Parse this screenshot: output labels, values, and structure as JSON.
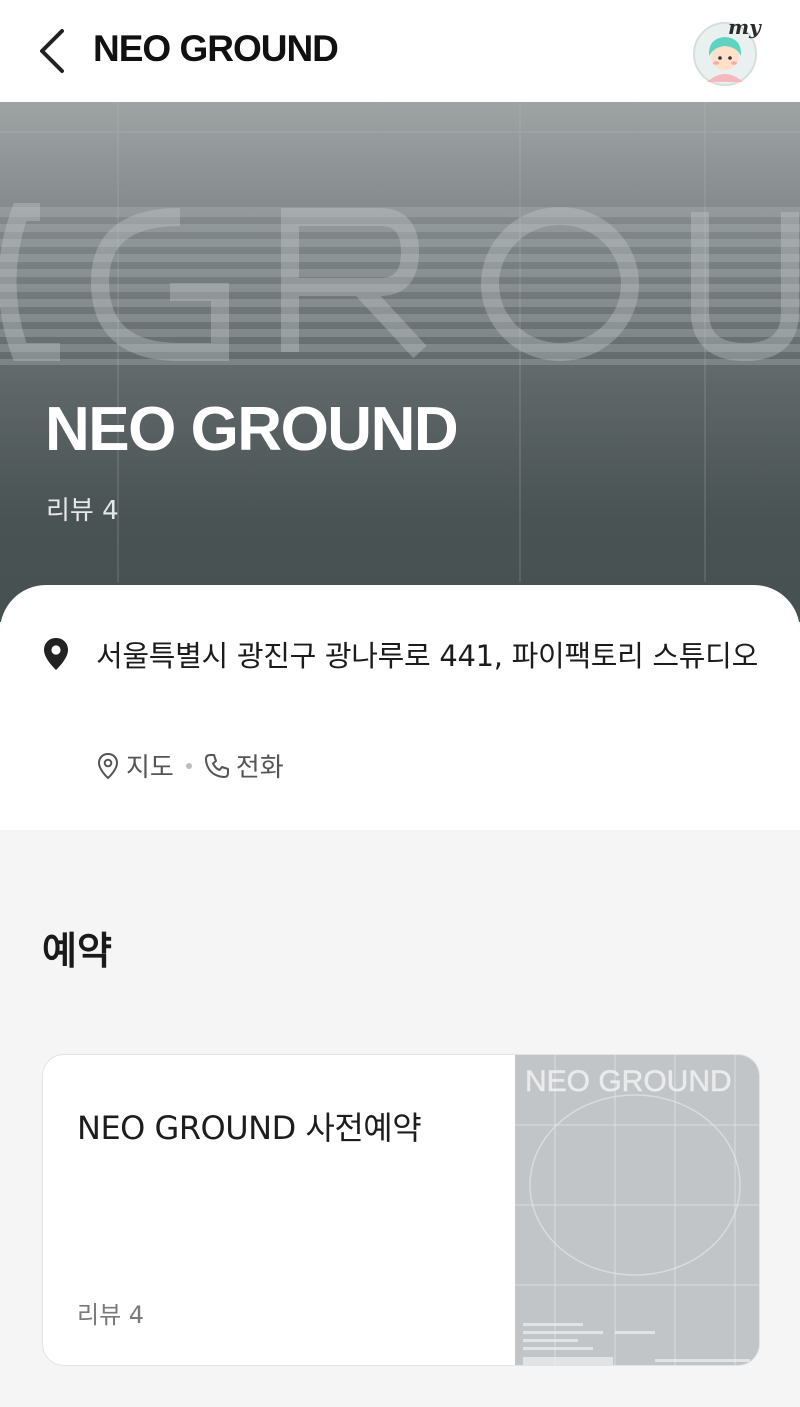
{
  "appbar": {
    "title": "NEO GROUND",
    "avatar_badge": "my",
    "back_icon": "chevron-left-icon",
    "avatar_icon": "profile-avatar-icon"
  },
  "hero": {
    "title": "NEO GROUND",
    "review_label": "리뷰 4"
  },
  "info": {
    "address": "서울특별시 광진구 광나루로 441, 파이팩토리 스튜디오",
    "map_label": "지도",
    "phone_label": "전화",
    "pin_icon": "location-pin-icon",
    "map_icon": "map-pin-outline-icon",
    "phone_icon": "phone-icon"
  },
  "reservation": {
    "section_title": "예약",
    "card_title": "NEO GROUND 사전예약",
    "card_review": "리뷰 4",
    "thumb_text": "NEO GROUND"
  },
  "colors": {
    "hero_top": "#9ea3a4",
    "hero_bottom": "#465050",
    "background": "#f5f5f5",
    "card": "#ffffff"
  }
}
